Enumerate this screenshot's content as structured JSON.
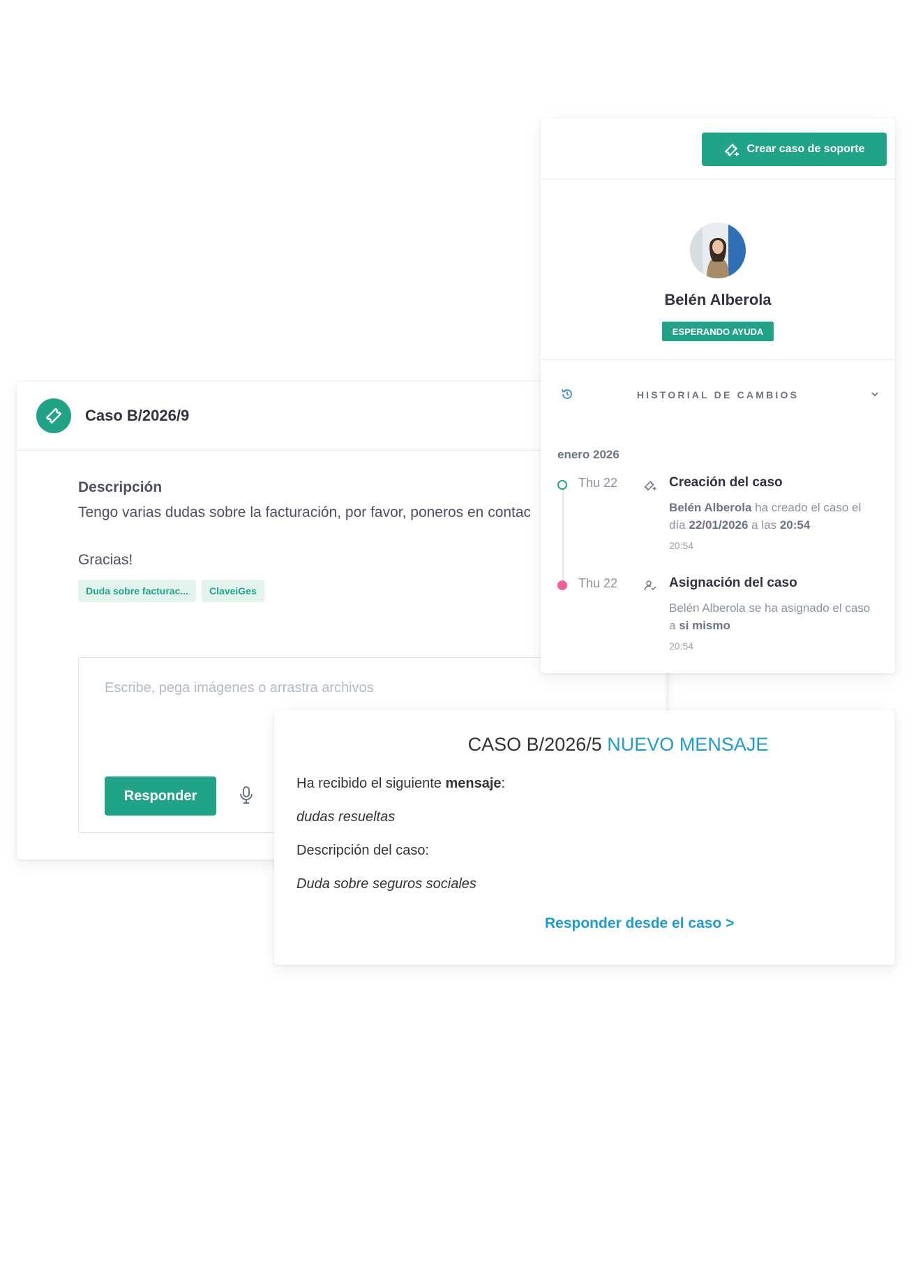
{
  "case": {
    "title": "Caso B/2026/9",
    "description_label": "Descripción",
    "description_text": "Tengo varias dudas sobre la facturación, por favor, poneros en contac",
    "thanks": "Gracias!",
    "tags": [
      "Duda sobre facturac...",
      "ClaveiGes"
    ],
    "reply_placeholder": "Escribe, pega imágenes o arrastra archivos",
    "reply_button": "Responder"
  },
  "panel": {
    "create_button": "Crear caso de soporte",
    "user_name": "Belén Alberola",
    "status": "ESPERANDO AYUDA",
    "history_title": "HISTORIAL DE CAMBIOS",
    "month": "enero 2026",
    "events": [
      {
        "date": "Thu 22",
        "title": "Creación del caso",
        "desc_name": "Belén Alberola",
        "desc_mid": " ha creado el caso el día ",
        "desc_date": "22/01/2026",
        "desc_mid2": " a las ",
        "desc_time": "20:54",
        "time": "20:54",
        "dot_color": "#21a387"
      },
      {
        "date": "Thu 22",
        "title": "Asignación del caso",
        "desc_pre": "Belén Alberola se ha asignado el caso a ",
        "desc_bold": "si mismo",
        "time": "20:54",
        "dot_color": "#f0609a"
      }
    ]
  },
  "email": {
    "title_part1": "CASO B/2026/5",
    "title_part2": "NUEVO MENSAJE",
    "line1_pre": "Ha recibido el siguiente ",
    "line1_bold": "mensaje",
    "line1_post": ":",
    "message": "dudas resueltas",
    "desc_label": "Descripción del caso:",
    "desc_value": "Duda sobre seguros sociales",
    "link": "Responder desde el caso >"
  },
  "colors": {
    "brand_green": "#21a387",
    "link_blue": "#1e9ccc",
    "pink_dot": "#f0609a"
  }
}
